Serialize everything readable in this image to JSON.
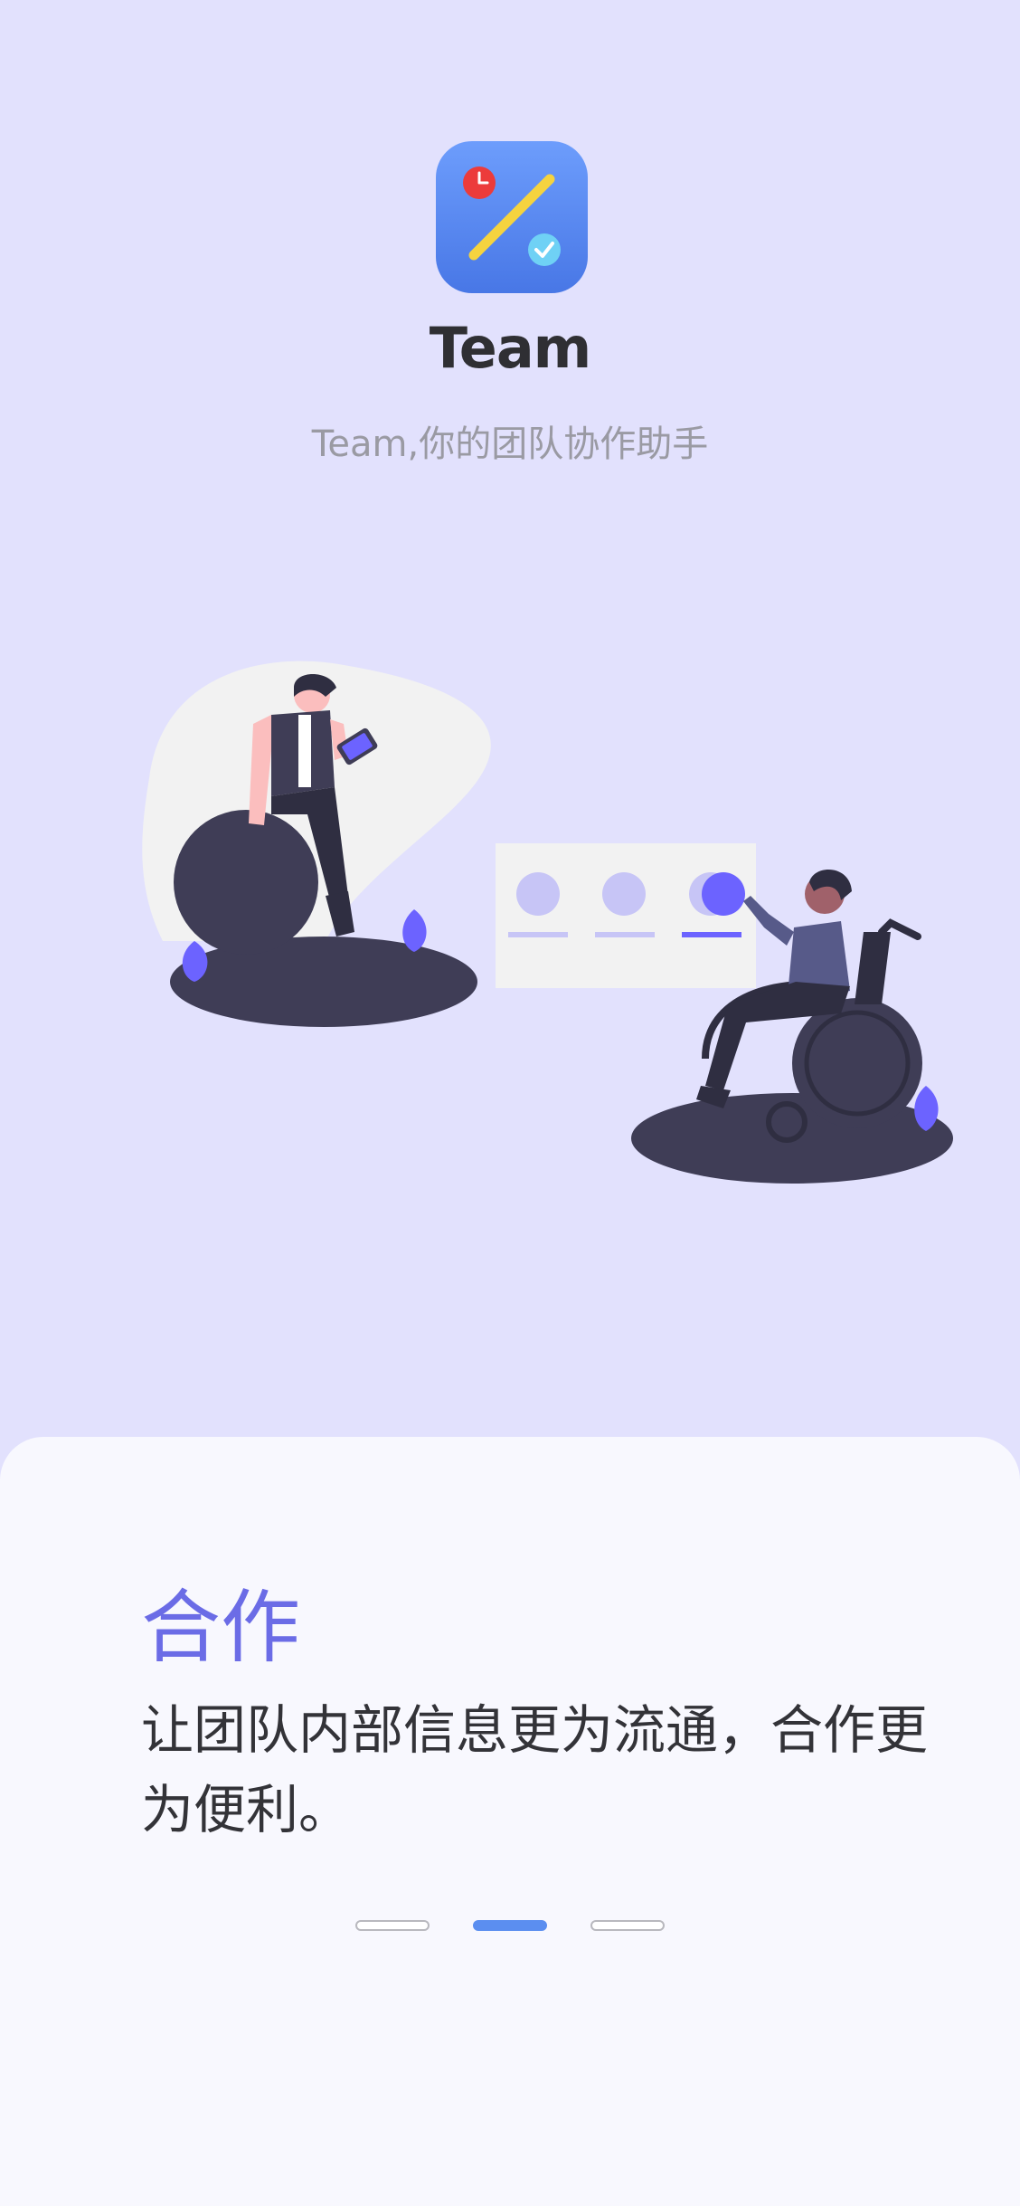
{
  "app": {
    "title": "Team",
    "subtitle": "Team,你的团队协作助手",
    "icon": "team-app-icon"
  },
  "onboarding": {
    "title": "合作",
    "description": "让团队内部信息更为流通，合作更为便利。",
    "page_count": 3,
    "active_page": 2
  },
  "colors": {
    "background": "#e2e1fd",
    "card": "#f8f8fe",
    "accent": "#6b6ce6",
    "pager_active": "#5b8ef0",
    "icon_gradient_top": "#6a9bfb",
    "icon_gradient_bottom": "#4a7de8"
  }
}
